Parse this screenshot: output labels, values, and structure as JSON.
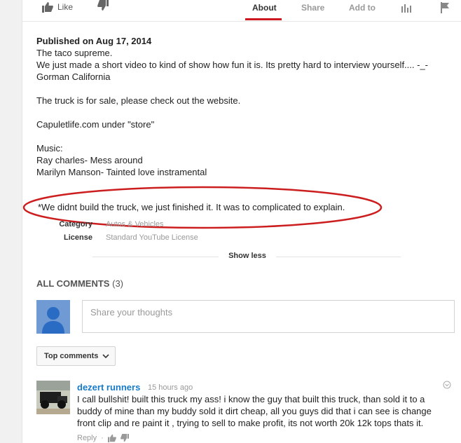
{
  "action_bar": {
    "like_label": "Like",
    "tabs": [
      "About",
      "Share",
      "Add to"
    ]
  },
  "description": {
    "published": "Published on Aug 17, 2014",
    "lines": [
      "The taco supreme.",
      "We just made a short video to kind of show how fun it is. Its pretty hard to interview yourself.... -_-",
      "Gorman California",
      "",
      "The truck is for sale, please check out the website.",
      "",
      "Capuletlife.com under \"store\"",
      "",
      "Music:",
      "Ray charles- Mess around",
      "Marilyn Manson- Tainted love instramental",
      ""
    ],
    "note": "*We didnt build the truck, we just finished it. It was to complicated to explain.",
    "highlight_color": "#cc1e1e"
  },
  "meta": {
    "category_label": "Category",
    "category_value": "Autos & Vehicles",
    "license_label": "License",
    "license_value": "Standard YouTube License"
  },
  "show_less": "Show less",
  "comments": {
    "title": "ALL COMMENTS",
    "count": "(3)",
    "share_placeholder": "Share your thoughts",
    "sort_label": "Top comments",
    "items": [
      {
        "author": "dezert runners",
        "time": "15 hours ago",
        "text": "I call bullshit! built this truck my ass!  i know the guy that built this truck, than sold it to a buddy of mine than my buddy sold it dirt cheap,  all you guys did that i can see is change front clip and re paint it ,  trying to sell to make profit, its not worth 20k 12k tops thats it.",
        "reply_label": "Reply",
        "separator": "·"
      }
    ]
  },
  "colors": {
    "accent_red": "#cc181e",
    "link_blue": "#167ac6",
    "avatar_blue": "#6f9ad3"
  },
  "icons": [
    "thumbs-up-icon",
    "thumbs-down-icon",
    "stats-icon",
    "flag-icon",
    "chevron-down-icon",
    "user-silhouette-icon",
    "menu-circle-icon"
  ]
}
